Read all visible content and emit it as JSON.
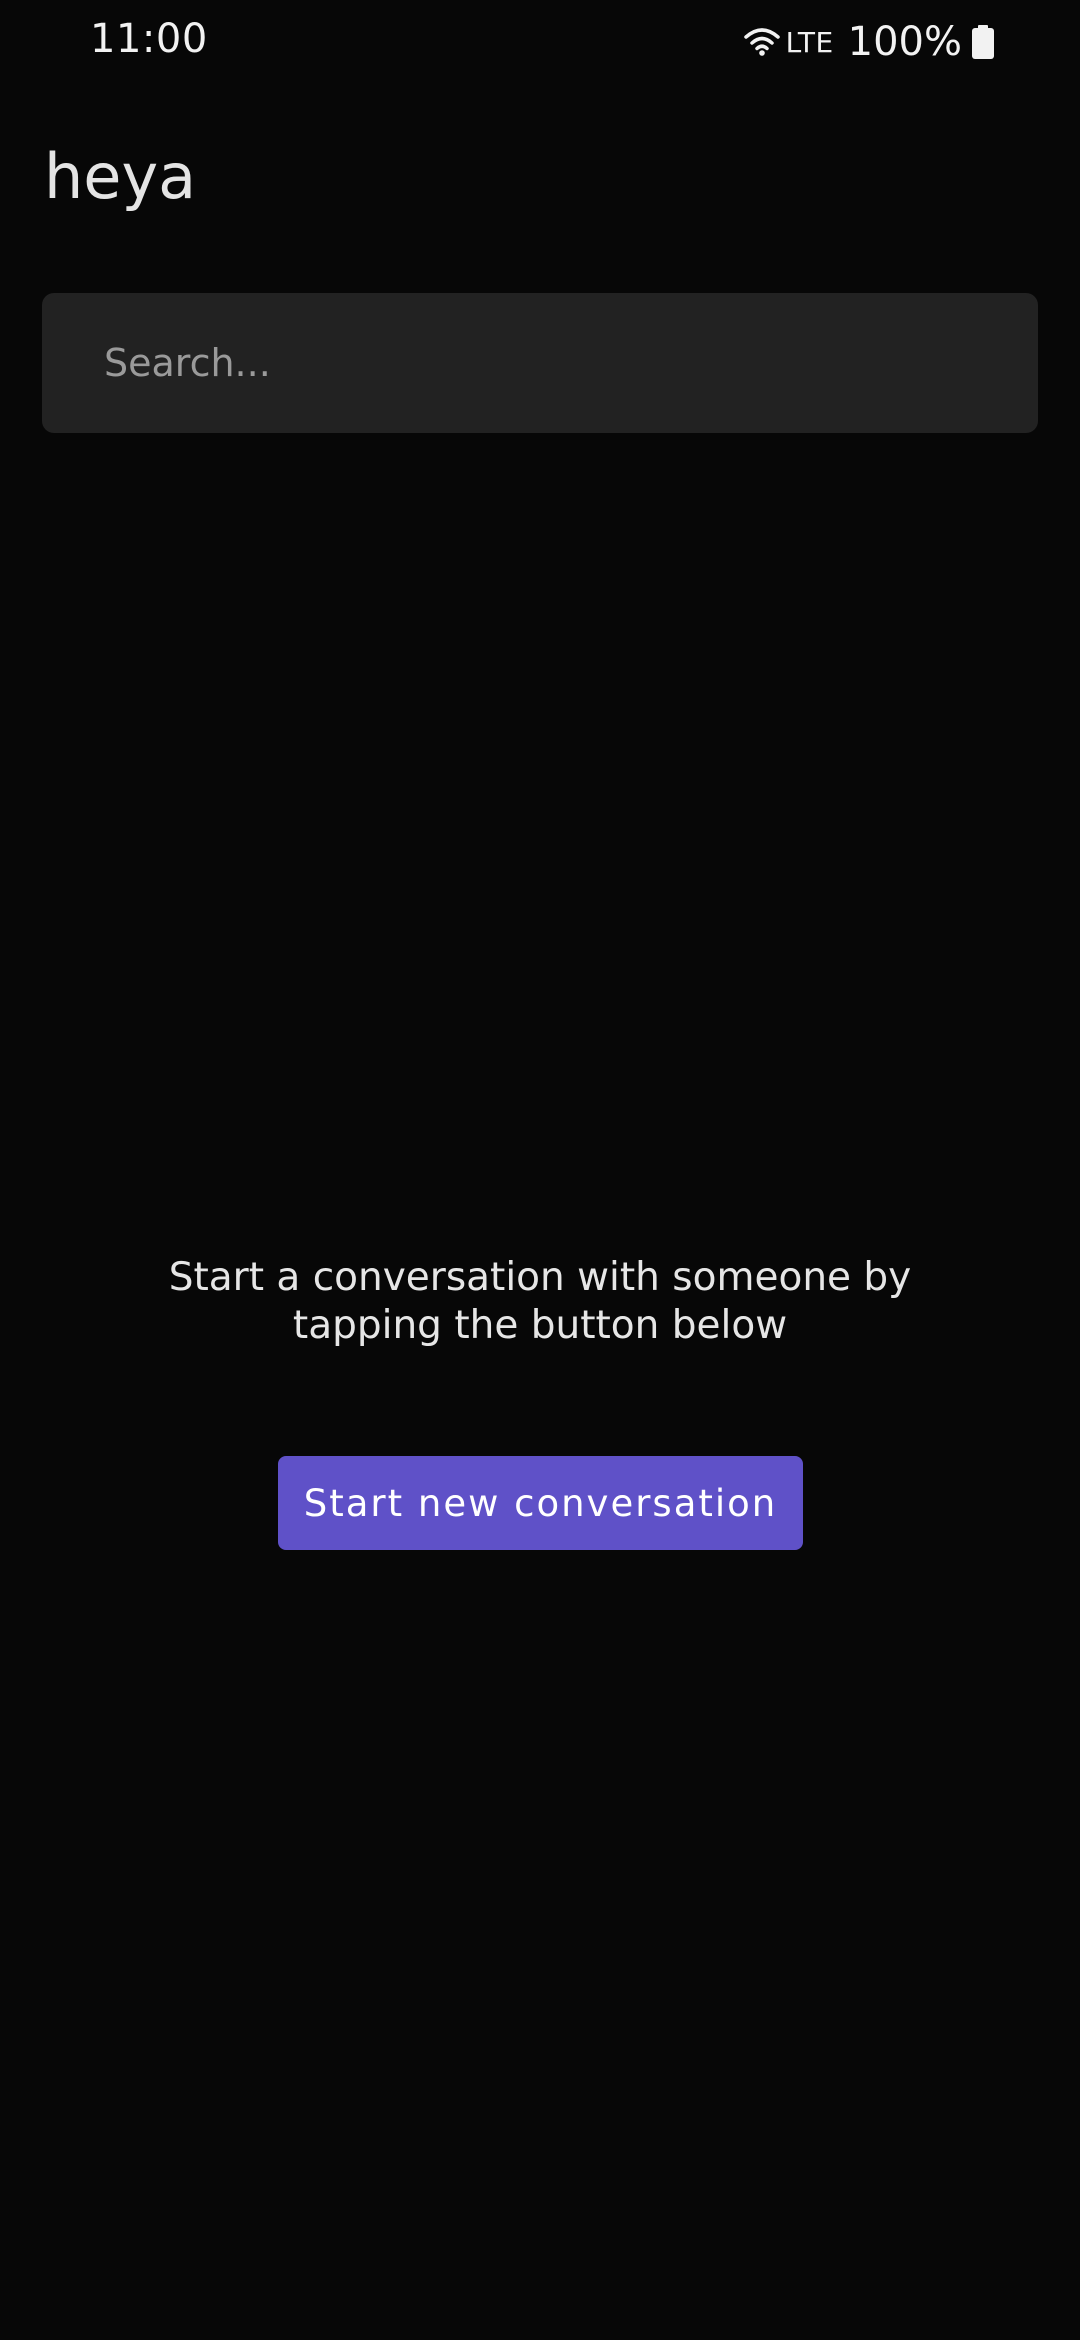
{
  "status_bar": {
    "time": "11:00",
    "network": "LTE",
    "battery": "100%",
    "icons": [
      "wifi-icon",
      "battery-icon"
    ]
  },
  "app": {
    "title": "heya"
  },
  "search": {
    "placeholder": "Search...",
    "value": ""
  },
  "empty_state": {
    "message": "Start a conversation with someone by tapping the button below",
    "button_label": "Start new conversation"
  },
  "colors": {
    "background": "#070707",
    "search_background": "#222222",
    "accent": "#5f51c8"
  }
}
